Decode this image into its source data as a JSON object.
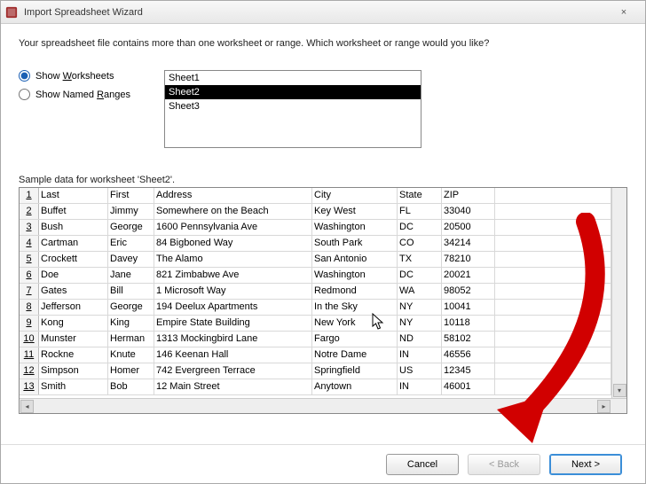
{
  "titlebar": {
    "title": "Import Spreadsheet Wizard",
    "close_label": "×"
  },
  "intro": "Your spreadsheet file contains more than one worksheet or range. Which worksheet or range would you like?",
  "radio": {
    "worksheets_prefix": "Show ",
    "worksheets_u": "W",
    "worksheets_suffix": "orksheets",
    "named_prefix": "Show Named ",
    "named_u": "R",
    "named_suffix": "anges"
  },
  "sheets": [
    "Sheet1",
    "Sheet2",
    "Sheet3"
  ],
  "selected_sheet_index": 1,
  "sample_label": "Sample data for worksheet 'Sheet2'.",
  "columns": [
    "Last",
    "First",
    "Address",
    "City",
    "State",
    "ZIP"
  ],
  "rows": [
    [
      "Last",
      "First",
      "Address",
      "City",
      "State",
      "ZIP"
    ],
    [
      "Buffet",
      "Jimmy",
      "Somewhere on the Beach",
      "Key West",
      "FL",
      "33040"
    ],
    [
      "Bush",
      "George",
      "1600 Pennsylvania Ave",
      "Washington",
      "DC",
      "20500"
    ],
    [
      "Cartman",
      "Eric",
      "84 Bigboned Way",
      "South Park",
      "CO",
      "34214"
    ],
    [
      "Crockett",
      "Davey",
      "The Alamo",
      "San Antonio",
      "TX",
      "78210"
    ],
    [
      "Doe",
      "Jane",
      "821 Zimbabwe Ave",
      "Washington",
      "DC",
      "20021"
    ],
    [
      "Gates",
      "Bill",
      "1 Microsoft Way",
      "Redmond",
      "WA",
      "98052"
    ],
    [
      "Jefferson",
      "George",
      "194 Deelux Apartments",
      "In the Sky",
      "NY",
      "10041"
    ],
    [
      "Kong",
      "King",
      "Empire State Building",
      "New York",
      "NY",
      "10118"
    ],
    [
      "Munster",
      "Herman",
      "1313 Mockingbird Lane",
      "Fargo",
      "ND",
      "58102"
    ],
    [
      "Rockne",
      "Knute",
      "146 Keenan Hall",
      "Notre Dame",
      "IN",
      "46556"
    ],
    [
      "Simpson",
      "Homer",
      "742 Evergreen Terrace",
      "Springfield",
      "US",
      "12345"
    ],
    [
      "Smith",
      "Bob",
      "12 Main Street",
      "Anytown",
      "IN",
      "46001"
    ]
  ],
  "buttons": {
    "cancel": "Cancel",
    "back": "< Back",
    "next": "Next >"
  }
}
